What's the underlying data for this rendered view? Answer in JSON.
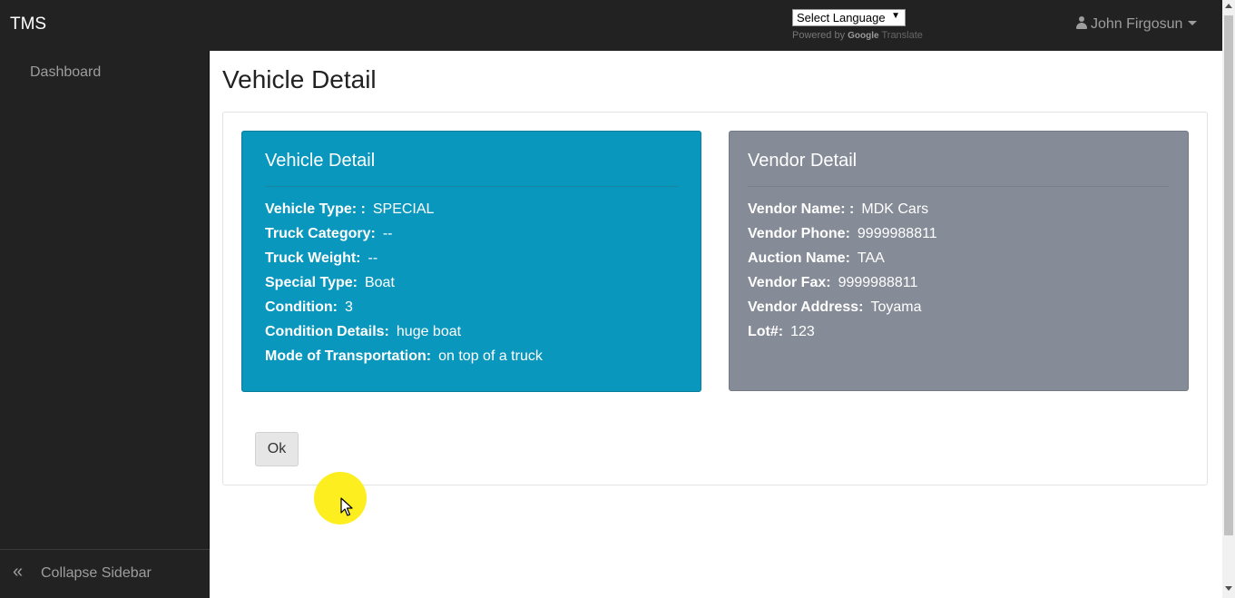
{
  "navbar": {
    "brand": "TMS",
    "translate": {
      "select_label": "Select Language",
      "select_arrow": "▼",
      "powered_by": "Powered by",
      "google": "Google",
      "translate_word": "Translate"
    },
    "user": {
      "name": "John Firgosun",
      "icon": "user-icon"
    }
  },
  "sidebar": {
    "items": [
      {
        "label": "Dashboard"
      }
    ],
    "collapse": {
      "icon": "double-chevron-left-icon",
      "glyph": "«",
      "label": "Collapse Sidebar"
    }
  },
  "page": {
    "title": "Vehicle Detail"
  },
  "vehicle_card": {
    "title": "Vehicle Detail",
    "color": "#0a97bd",
    "fields": [
      {
        "key": "Vehicle Type: :",
        "value": "SPECIAL"
      },
      {
        "key": "Truck Category:",
        "value": "--"
      },
      {
        "key": "Truck Weight:",
        "value": "--"
      },
      {
        "key": "Special Type:",
        "value": "Boat"
      },
      {
        "key": "Condition:",
        "value": "3"
      },
      {
        "key": "Condition Details:",
        "value": "huge boat"
      },
      {
        "key": "Mode of Transportation:",
        "value": "on top of a truck"
      }
    ]
  },
  "vendor_card": {
    "title": "Vendor Detail",
    "color": "#868c97",
    "fields": [
      {
        "key": "Vendor Name: :",
        "value": "MDK Cars"
      },
      {
        "key": "Vendor Phone:",
        "value": "9999988811"
      },
      {
        "key": "Auction Name:",
        "value": "TAA"
      },
      {
        "key": "Vendor Fax:",
        "value": "9999988811"
      },
      {
        "key": "Vendor Address:",
        "value": "Toyama"
      },
      {
        "key": "Lot#:",
        "value": "123"
      }
    ]
  },
  "actions": {
    "ok_label": "Ok"
  },
  "overlay": {
    "cursor_highlight_color": "#fcee1f"
  }
}
